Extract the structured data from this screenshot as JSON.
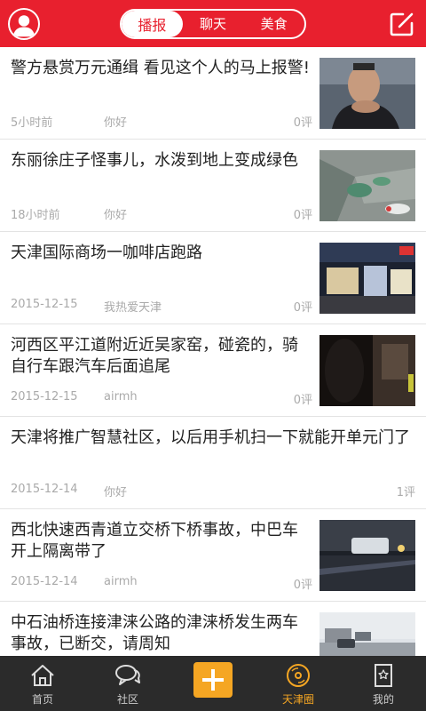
{
  "header": {
    "tabs": [
      {
        "label": "播报",
        "active": true
      },
      {
        "label": "聊天",
        "active": false
      },
      {
        "label": "美食",
        "active": false
      }
    ],
    "accent_color": "#e8202e"
  },
  "feed": {
    "items": [
      {
        "title": "警方悬赏万元通缉 看见这个人的马上报警!",
        "time": "5小时前",
        "author": "你好",
        "comments": "0评",
        "thumb": "portrait-photo"
      },
      {
        "title": "东丽徐庄子怪事儿，水泼到地上变成绿色",
        "time": "18小时前",
        "author": "你好",
        "comments": "0评",
        "thumb": "wet-ground-photo"
      },
      {
        "title": "天津国际商场一咖啡店跑路",
        "time": "2015-12-15",
        "author": "我热爱天津",
        "comments": "0评",
        "thumb": "shop-night-photo"
      },
      {
        "title": "河西区平江道附近近吴家窑，碰瓷的，骑自行车跟汽车后面追尾",
        "time": "2015-12-15",
        "author": "airmh",
        "comments": "0评",
        "thumb": "night-street-photo"
      },
      {
        "title": "天津将推广智慧社区，以后用手机扫一下就能开单元门了",
        "time": "2015-12-14",
        "author": "你好",
        "comments": "1评",
        "thumb": null
      },
      {
        "title": "西北快速西青道立交桥下桥事故，中巴车开上隔离带了",
        "time": "2015-12-14",
        "author": "airmh",
        "comments": "0评",
        "thumb": "accident-night-photo"
      },
      {
        "title": "中石油桥连接津涞公路的津涞桥发生两车事故，已断交，请周知",
        "time": "",
        "author": "",
        "comments": "",
        "thumb": "road-day-photo"
      }
    ]
  },
  "tabbar": {
    "tabs": [
      {
        "label": "首页",
        "icon": "home-icon",
        "active": false
      },
      {
        "label": "社区",
        "icon": "chat-bubbles-icon",
        "active": false
      },
      {
        "label": "",
        "icon": "plus-icon",
        "active": false
      },
      {
        "label": "天津圈",
        "icon": "record-disc-icon",
        "active": true
      },
      {
        "label": "我的",
        "icon": "profile-card-icon",
        "active": false
      }
    ],
    "active_color": "#f5a623"
  }
}
